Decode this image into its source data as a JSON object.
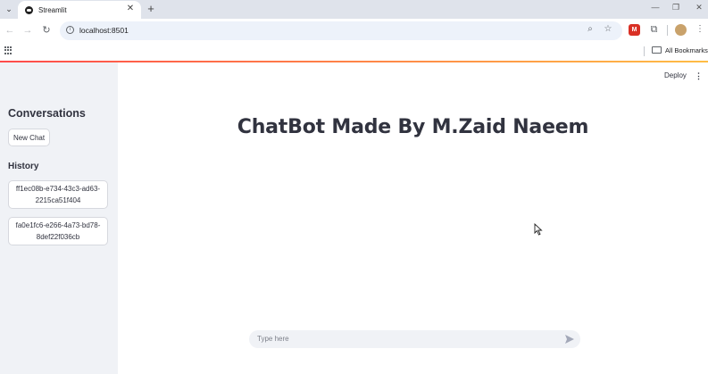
{
  "browser": {
    "tab_title": "Streamlit",
    "tab_close": "✕",
    "new_tab": "+",
    "url": "localhost:8501",
    "bookmarks_label": "All Bookmarks",
    "icons": [
      "tab-menu-icon",
      "back-icon",
      "forward-icon",
      "reload-icon",
      "info-icon",
      "zoom-icon",
      "star-icon",
      "extension-icon",
      "puzzle-icon",
      "profile-avatar",
      "more-icon",
      "apps-icon",
      "folder-icon"
    ]
  },
  "sidebar": {
    "title": "Conversations",
    "new_chat_label": "New Chat",
    "history_title": "History",
    "history_items": [
      "ff1ec08b-e734-43c3-ad63-2215ca51f404",
      "fa0e1fc6-e266-4a73-bd78-8def22f036cb"
    ]
  },
  "main": {
    "deploy_label": "Deploy",
    "title": "ChatBot Made By M.Zaid Naeem",
    "chat_placeholder": "Type here"
  },
  "colors": {
    "sidebar_bg": "#f0f2f6",
    "text": "#31333f",
    "accent_start": "#ff4b4b",
    "accent_end": "#ffbd45"
  }
}
